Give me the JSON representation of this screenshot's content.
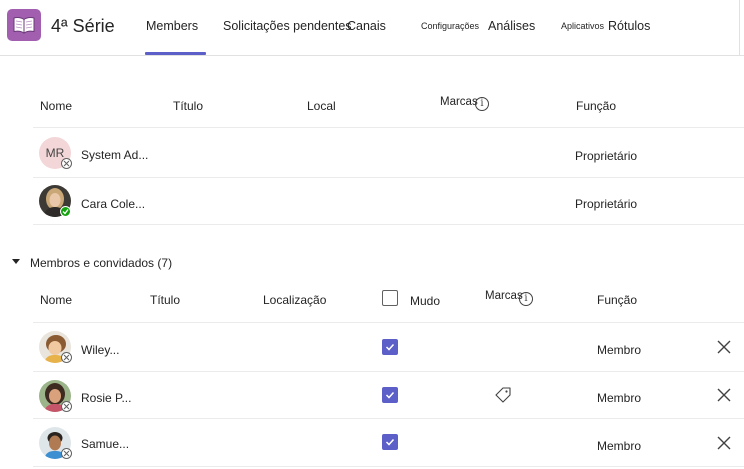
{
  "header": {
    "team_name": "4ª Série",
    "tabs": [
      {
        "label": "Members",
        "active": true
      },
      {
        "label": "Solicitações pendentes"
      },
      {
        "label": "Canais"
      },
      {
        "label": "Configurações"
      },
      {
        "label": "Análises"
      },
      {
        "label": "Aplicativos"
      },
      {
        "label": "Rótulos"
      }
    ],
    "icon": "book-icon",
    "accent_color": "#5b5fc7"
  },
  "owners": {
    "columns": {
      "name": "Nome",
      "title": "Título",
      "location": "Local",
      "tags": "Marcas",
      "role": "Função"
    },
    "rows": [
      {
        "initials": "MR",
        "name": "System Ad...",
        "role": "Proprietário",
        "status": "offline"
      },
      {
        "name": "Cara Cole...",
        "role": "Proprietário",
        "status": "online"
      }
    ]
  },
  "members": {
    "section_label": "Membros e convidados (7)",
    "columns": {
      "name": "Nome",
      "title": "Título",
      "location": "Localização",
      "mute": "Mudo",
      "tags": "Marcas",
      "role": "Função"
    },
    "rows": [
      {
        "name": "Wiley...",
        "role": "Membro",
        "muted": true,
        "has_tag": false
      },
      {
        "name": "Rosie P...",
        "role": "Membro",
        "muted": true,
        "has_tag": true
      },
      {
        "name": "Samue...",
        "role": "Membro",
        "muted": true,
        "has_tag": false
      }
    ]
  }
}
